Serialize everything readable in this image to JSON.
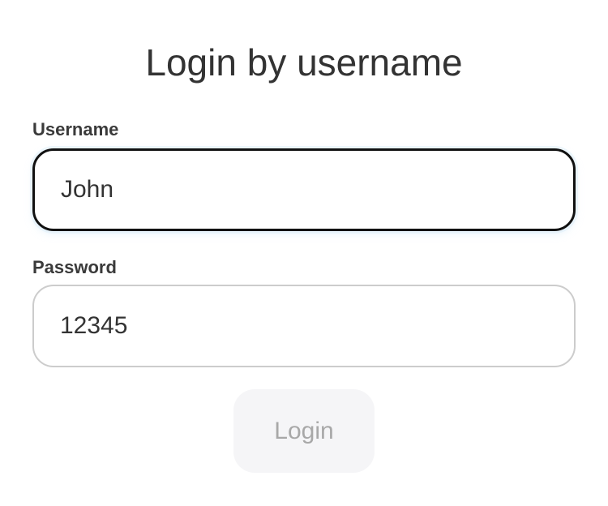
{
  "form": {
    "title": "Login by username",
    "username": {
      "label": "Username",
      "value": "John",
      "focused": true
    },
    "password": {
      "label": "Password",
      "value": "12345"
    },
    "login_button": {
      "label": "Login",
      "disabled": true
    }
  }
}
